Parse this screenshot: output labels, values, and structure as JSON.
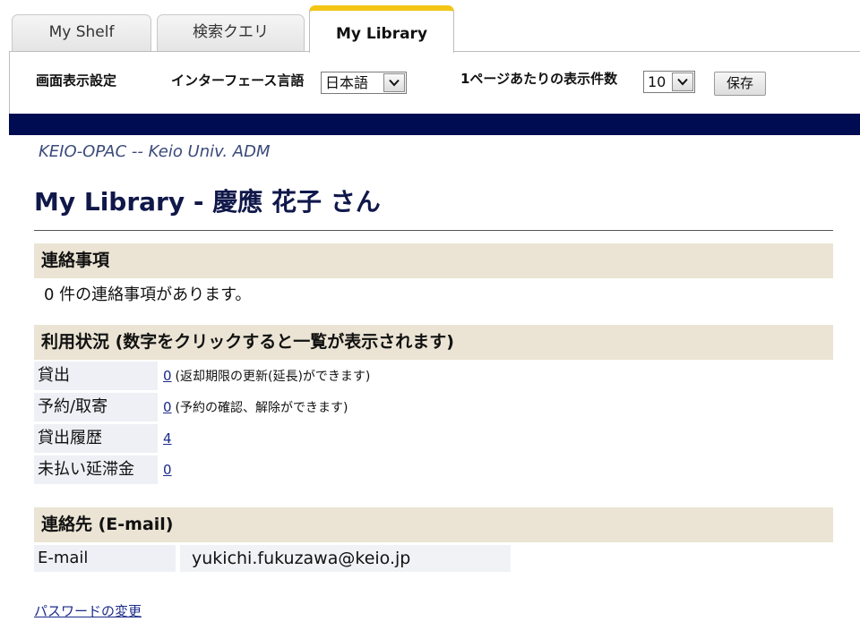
{
  "tabs": [
    {
      "label": "My Shelf"
    },
    {
      "label": "検索クエリ"
    },
    {
      "label": "My Library",
      "active": true
    }
  ],
  "settings": {
    "display_settings_label": "画面表示設定",
    "interface_language_label": "インターフェース言語",
    "language_value": "日本語",
    "per_page_label": "1ページあたりの表示件数",
    "per_page_value": "10",
    "save_label": "保存"
  },
  "header": {
    "opac_title": "KEIO-OPAC -- Keio Univ. ADM",
    "page_title": "My Library - 慶應 花子 さん"
  },
  "notices": {
    "heading": "連絡事項",
    "text": "0 件の連絡事項があります。"
  },
  "usage": {
    "heading": "利用状況 (数字をクリックすると一覧が表示されます)",
    "rows": [
      {
        "label": "貸出",
        "count": "0",
        "note": "(返却期限の更新(延長)ができます)"
      },
      {
        "label": "予約/取寄",
        "count": "0",
        "note": "(予約の確認、解除ができます)"
      },
      {
        "label": "貸出履歴",
        "count": "4",
        "note": ""
      },
      {
        "label": "未払い延滞金",
        "count": "0",
        "note": ""
      }
    ]
  },
  "contact": {
    "heading": "連絡先 (E-mail)",
    "email_label": "E-mail",
    "email_value": "yukichi.fukuzawa@keio.jp"
  },
  "footer": {
    "change_password_link": "パスワードの変更"
  },
  "colors": {
    "navy_bar": "#000c52",
    "active_tab_accent": "#f3c514",
    "section_header_bg": "#ebe4d4",
    "row_label_bg": "#eef0f5",
    "link": "#1a2a8a"
  },
  "icons": {
    "select_arrow": "chevron-down-icon"
  }
}
